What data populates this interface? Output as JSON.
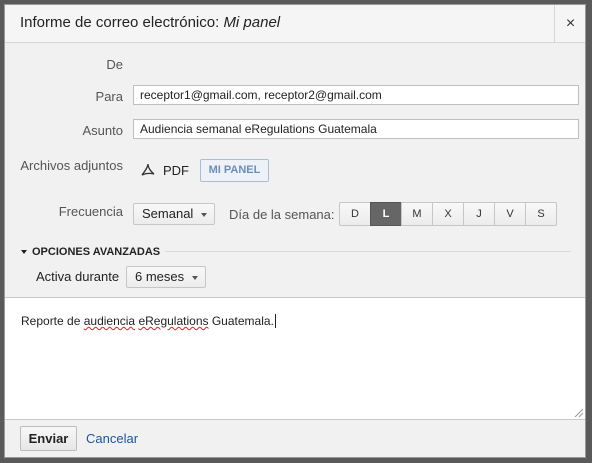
{
  "dialog": {
    "title_prefix": "Informe de correo electrónico:",
    "title_italic": "Mi panel",
    "close_glyph": "×"
  },
  "form": {
    "from_label": "De",
    "to_label": "Para",
    "to_value": "receptor1@gmail.com, receptor2@gmail.com",
    "subject_label": "Asunto",
    "subject_value": "Audiencia semanal eRegulations Guatemala",
    "attachments_label": "Archivos adjuntos",
    "attachment_pdf": "PDF",
    "attachment_panel": "MI PANEL",
    "frequency_label": "Frecuencia",
    "frequency_value": "Semanal",
    "weekday_label": "Día de la semana:",
    "weekdays": [
      "D",
      "L",
      "M",
      "X",
      "J",
      "V",
      "S"
    ],
    "selected_weekday": "L"
  },
  "advanced": {
    "toggle_label": "OPCIONES AVANZADAS",
    "active_label": "Activa durante",
    "active_value": "6 meses"
  },
  "message": {
    "part1": "Reporte de ",
    "misspelled1": "audiencia",
    "part2": " ",
    "misspelled2": "eRegulations",
    "part3": " Guatemala."
  },
  "footer": {
    "send_label": "Enviar",
    "cancel_label": "Cancelar"
  },
  "colors": {
    "link": "#1a55a8",
    "panel_button_text": "#6e8db6",
    "active_day_bg": "#666666"
  }
}
